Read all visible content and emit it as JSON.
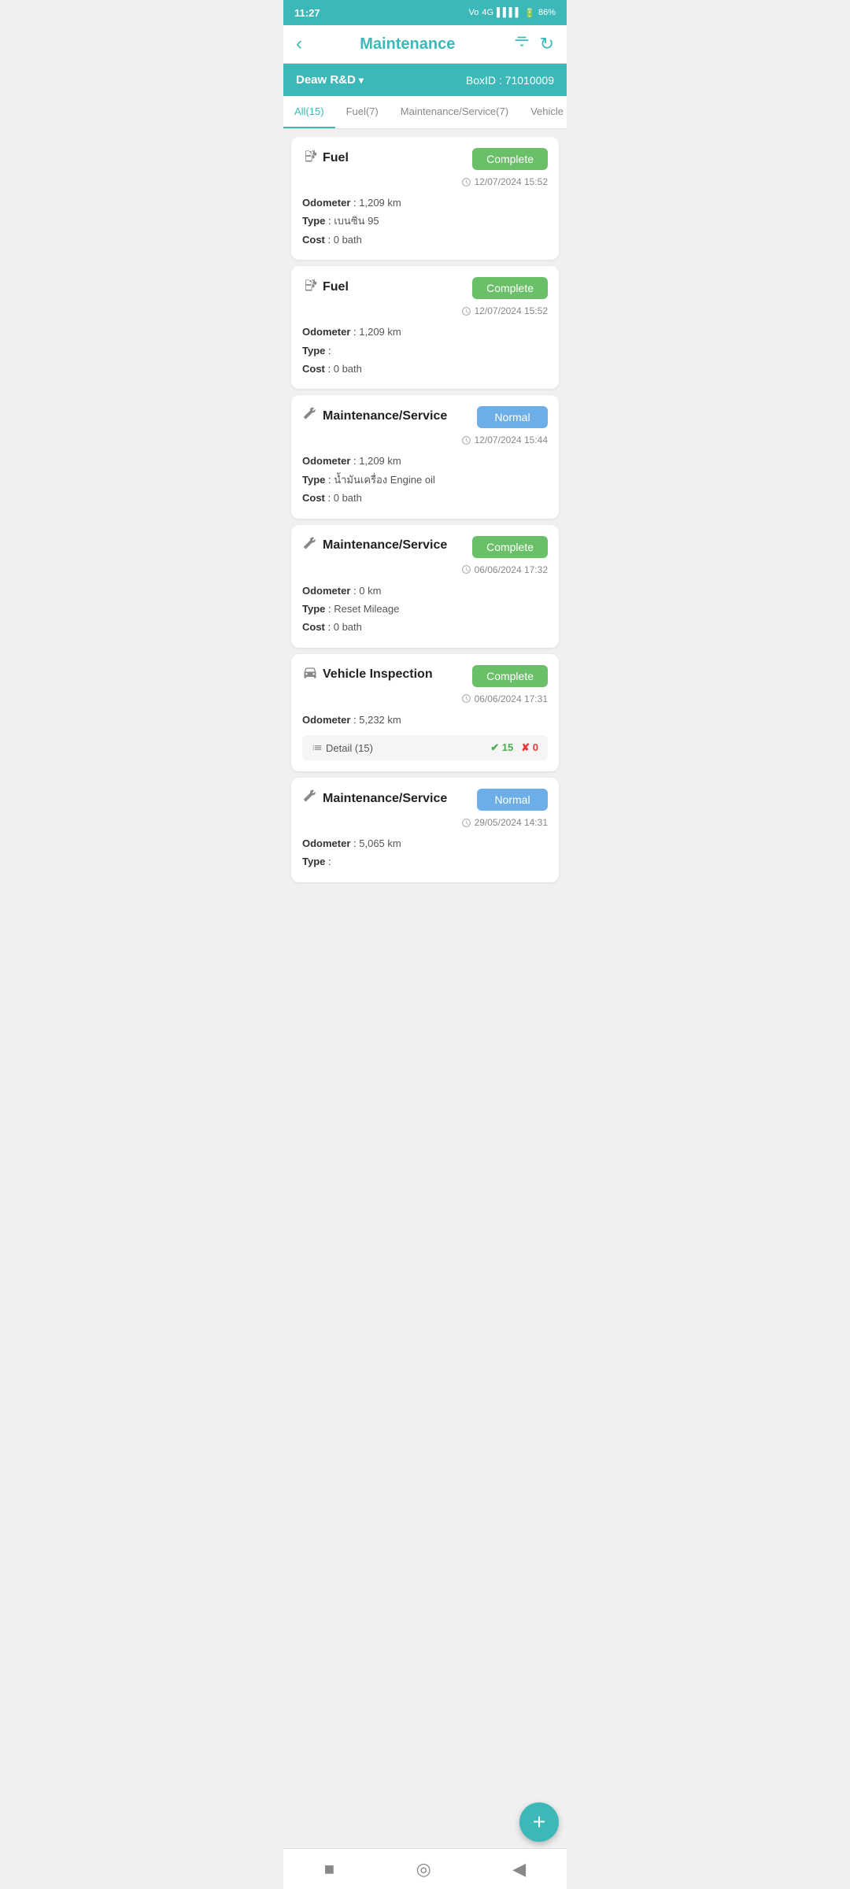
{
  "statusBar": {
    "time": "11:27",
    "battery": "86%"
  },
  "appBar": {
    "title": "Maintenance",
    "backIcon": "‹",
    "filterIcon": "⛉",
    "refreshIcon": "↻"
  },
  "locationBar": {
    "name": "Deaw R&D",
    "dropdownIcon": "▾",
    "boxIdLabel": "BoxID :",
    "boxIdValue": "71010009"
  },
  "tabs": [
    {
      "label": "All(15)",
      "active": true
    },
    {
      "label": "Fuel(7)",
      "active": false
    },
    {
      "label": "Maintenance/Service(7)",
      "active": false
    },
    {
      "label": "Vehicle Inspection(",
      "active": false
    }
  ],
  "cards": [
    {
      "id": 1,
      "type": "fuel",
      "icon": "⛽",
      "title": "Fuel",
      "status": "Complete",
      "statusType": "complete",
      "odometer": "1,209 km",
      "type_label": "เบนซิน 95",
      "cost": "0 bath",
      "datetime": "12/07/2024  15:52",
      "hasDetail": false
    },
    {
      "id": 2,
      "type": "fuel",
      "icon": "⛽",
      "title": "Fuel",
      "status": "Complete",
      "statusType": "complete",
      "odometer": "1,209 km",
      "type_label": "",
      "cost": "0 bath",
      "datetime": "12/07/2024  15:52",
      "hasDetail": false
    },
    {
      "id": 3,
      "type": "maintenance",
      "icon": "🔧",
      "title": "Maintenance/Service",
      "status": "Normal",
      "statusType": "normal",
      "odometer": "1,209 km",
      "type_label": "น้ำมันเครื่อง Engine oil",
      "cost": "0 bath",
      "datetime": "12/07/2024  15:44",
      "hasDetail": false
    },
    {
      "id": 4,
      "type": "maintenance",
      "icon": "🔧",
      "title": "Maintenance/Service",
      "status": "Complete",
      "statusType": "complete",
      "odometer": "0 km",
      "type_label": "Reset Mileage",
      "cost": "0 bath",
      "datetime": "06/06/2024  17:32",
      "hasDetail": false
    },
    {
      "id": 5,
      "type": "inspection",
      "icon": "🚗",
      "title": "Vehicle Inspection",
      "status": "Complete",
      "statusType": "complete",
      "odometer": "5,232 km",
      "type_label": "",
      "cost": "",
      "datetime": "06/06/2024  17:31",
      "hasDetail": true,
      "detailLabel": "Detail (15)",
      "passCount": 15,
      "failCount": 0
    },
    {
      "id": 6,
      "type": "maintenance",
      "icon": "🔧",
      "title": "Maintenance/Service",
      "status": "Normal",
      "statusType": "normal",
      "odometer": "5,065 km",
      "type_label": "",
      "cost": "",
      "datetime": "29/05/2024  14:31",
      "hasDetail": false,
      "partial": true
    }
  ],
  "fab": {
    "icon": "+"
  },
  "bottomNav": {
    "squareIcon": "■",
    "circleIcon": "◎",
    "backIcon": "◀"
  },
  "labels": {
    "odometer": "Odometer :",
    "type": "Type :",
    "cost": "Cost :"
  }
}
